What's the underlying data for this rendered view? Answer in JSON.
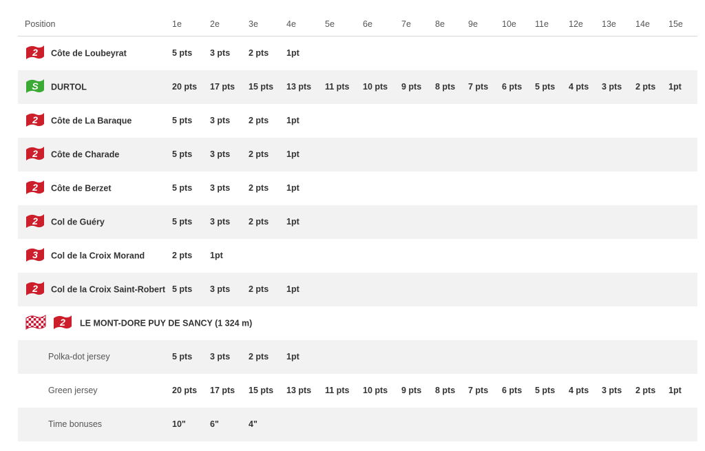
{
  "header": {
    "position": "Position",
    "places": [
      "1e",
      "2e",
      "3e",
      "4e",
      "5e",
      "6e",
      "7e",
      "8e",
      "9e",
      "10e",
      "11e",
      "12e",
      "13e",
      "14e",
      "15e"
    ]
  },
  "colors": {
    "climb_red": "#cc1f2b",
    "sprint_green": "#3aaa35",
    "row_alt": "#f2f2f2"
  },
  "rows": [
    {
      "icon": "climb-category-2-flag-icon",
      "badge": "2",
      "label": "Côte de Loubeyrat",
      "points": [
        "5 pts",
        "3 pts",
        "2 pts",
        "1pt"
      ]
    },
    {
      "icon": "sprint-flag-icon",
      "badge": "S",
      "label": "DURTOL",
      "points": [
        "20 pts",
        "17 pts",
        "15 pts",
        "13 pts",
        "11 pts",
        "10 pts",
        "9 pts",
        "8 pts",
        "7 pts",
        "6 pts",
        "5 pts",
        "4 pts",
        "3 pts",
        "2 pts",
        "1pt"
      ]
    },
    {
      "icon": "climb-category-2-flag-icon",
      "badge": "2",
      "label": "Côte de La Baraque",
      "points": [
        "5 pts",
        "3 pts",
        "2 pts",
        "1pt"
      ]
    },
    {
      "icon": "climb-category-2-flag-icon",
      "badge": "2",
      "label": "Côte de Charade",
      "points": [
        "5 pts",
        "3 pts",
        "2 pts",
        "1pt"
      ]
    },
    {
      "icon": "climb-category-2-flag-icon",
      "badge": "2",
      "label": "Côte de Berzet",
      "points": [
        "5 pts",
        "3 pts",
        "2 pts",
        "1pt"
      ]
    },
    {
      "icon": "climb-category-2-flag-icon",
      "badge": "2",
      "label": "Col de Guéry",
      "points": [
        "5 pts",
        "3 pts",
        "2 pts",
        "1pt"
      ]
    },
    {
      "icon": "climb-category-3-flag-icon",
      "badge": "3",
      "label": "Col de la Croix Morand",
      "points": [
        "2 pts",
        "1pt"
      ]
    },
    {
      "icon": "climb-category-2-flag-icon",
      "badge": "2",
      "label": "Col de la Croix Saint-Robert",
      "points": [
        "5 pts",
        "3 pts",
        "2 pts",
        "1pt"
      ]
    }
  ],
  "finish": {
    "badge": "2",
    "label": "LE MONT-DORE PUY DE SANCY (1 324 m)",
    "subrows": [
      {
        "label": "Polka-dot jersey",
        "points": [
          "5 pts",
          "3 pts",
          "2 pts",
          "1pt"
        ]
      },
      {
        "label": "Green jersey",
        "points": [
          "20 pts",
          "17 pts",
          "15 pts",
          "13 pts",
          "11 pts",
          "10 pts",
          "9 pts",
          "8 pts",
          "7 pts",
          "6 pts",
          "5 pts",
          "4 pts",
          "3 pts",
          "2 pts",
          "1pt"
        ]
      },
      {
        "label": "Time bonuses",
        "points": [
          "10\"",
          "6\"",
          "4\""
        ]
      }
    ]
  }
}
